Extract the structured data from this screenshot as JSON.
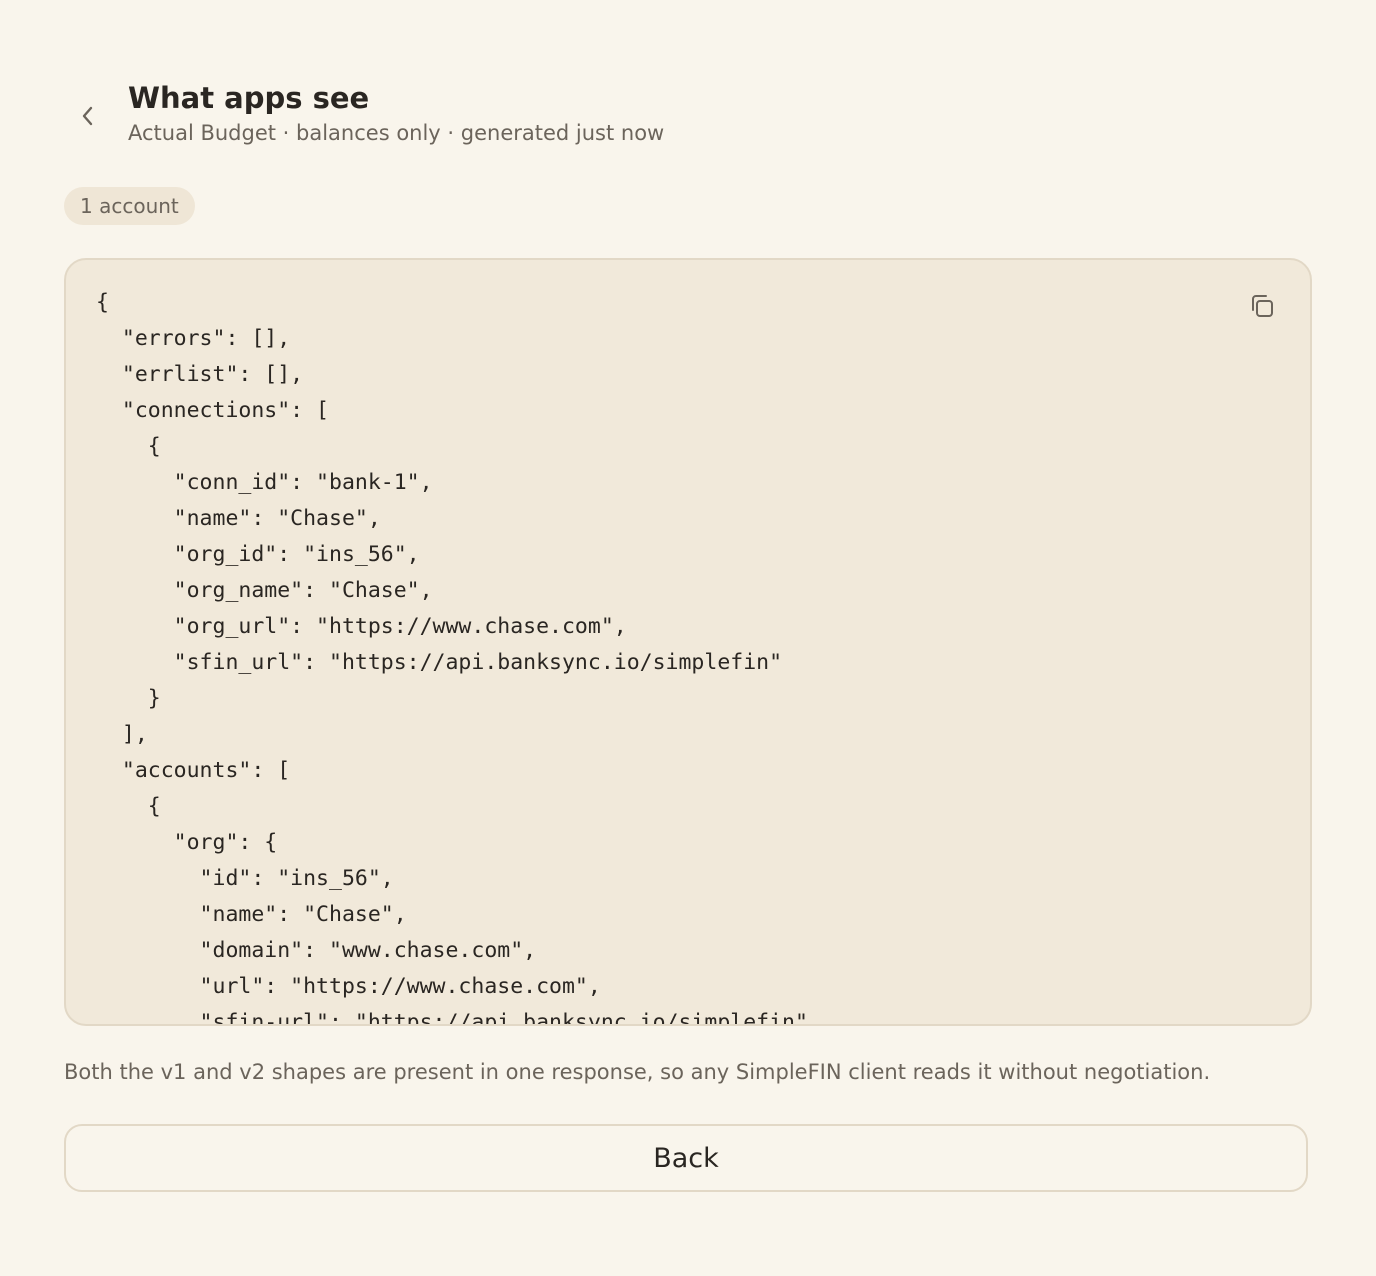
{
  "header": {
    "back_icon": "chevron-left-icon",
    "title": "What apps see",
    "subtitle": "Actual Budget · balances only · generated just now"
  },
  "summary": {
    "count_label": "1 account"
  },
  "code_panel": {
    "copy_icon": "copy-icon",
    "lines": [
      "{",
      "  \"errors\": [],",
      "  \"errlist\": [],",
      "  \"connections\": [",
      "    {",
      "      \"conn_id\": \"bank-1\",",
      "      \"name\": \"Chase\",",
      "      \"org_id\": \"ins_56\",",
      "      \"org_name\": \"Chase\",",
      "      \"org_url\": \"https://www.chase.com\",",
      "      \"sfin_url\": \"https://api.banksync.io/simplefin\"",
      "    }",
      "  ],",
      "  \"accounts\": [",
      "    {",
      "      \"org\": {",
      "        \"id\": \"ins_56\",",
      "        \"name\": \"Chase\",",
      "        \"domain\": \"www.chase.com\",",
      "        \"url\": \"https://www.chase.com\",",
      "        \"sfin-url\": \"https://api.banksync.io/simplefin\""
    ]
  },
  "footnote": "Both the v1 and v2 shapes are present in one response, so any SimpleFIN client reads it without negotiation.",
  "actions": {
    "back_label": "Back"
  },
  "colors": {
    "background": "#f9f5ec",
    "panel": "#f1e9da",
    "border": "#e2d8c6",
    "text": "#2a2622",
    "muted": "#6b645b"
  }
}
